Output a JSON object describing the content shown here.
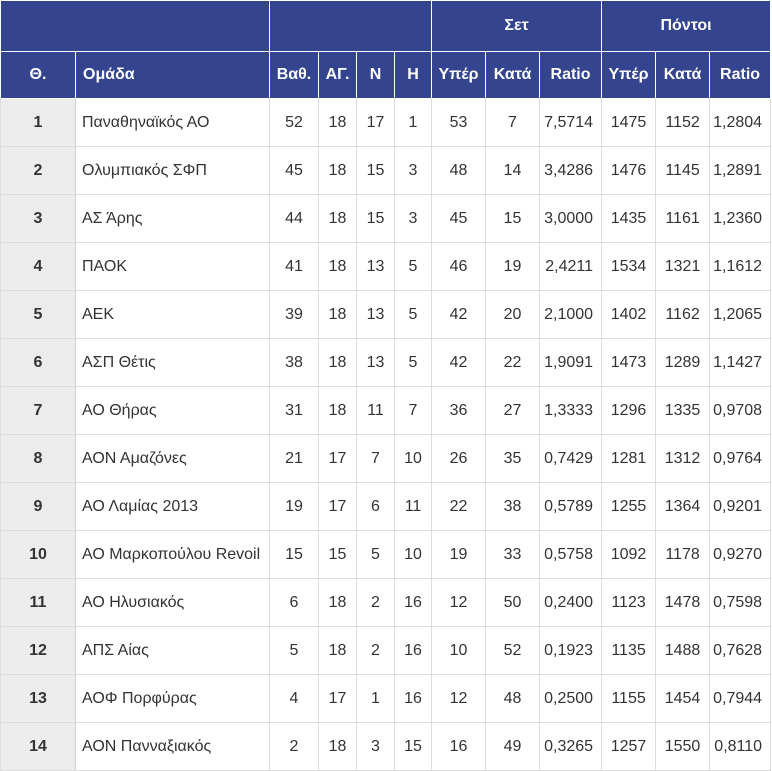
{
  "table": {
    "groups": {
      "sets": "Σετ",
      "points": "Πόντοι"
    },
    "headers": {
      "pos": "Θ.",
      "team": "Ομάδα",
      "pts": "Βαθ.",
      "played": "ΑΓ.",
      "won": "Ν",
      "lost": "Η",
      "sets_for": "Υπέρ",
      "sets_against": "Κατά",
      "sets_ratio": "Ratio",
      "points_for": "Υπέρ",
      "points_against": "Κατά",
      "points_ratio": "Ratio"
    },
    "rows": [
      {
        "pos": "1",
        "team": "Παναθηναϊκός ΑΟ",
        "pts": "52",
        "played": "18",
        "won": "17",
        "lost": "1",
        "sets_for": "53",
        "sets_against": "7",
        "sets_ratio": "7,5714",
        "points_for": "1475",
        "points_against": "1152",
        "points_ratio": "1,2804"
      },
      {
        "pos": "2",
        "team": "Ολυμπιακός ΣΦΠ",
        "pts": "45",
        "played": "18",
        "won": "15",
        "lost": "3",
        "sets_for": "48",
        "sets_against": "14",
        "sets_ratio": "3,4286",
        "points_for": "1476",
        "points_against": "1145",
        "points_ratio": "1,2891"
      },
      {
        "pos": "3",
        "team": "ΑΣ Άρης",
        "pts": "44",
        "played": "18",
        "won": "15",
        "lost": "3",
        "sets_for": "45",
        "sets_against": "15",
        "sets_ratio": "3,0000",
        "points_for": "1435",
        "points_against": "1161",
        "points_ratio": "1,2360"
      },
      {
        "pos": "4",
        "team": "ΠΑΟΚ",
        "pts": "41",
        "played": "18",
        "won": "13",
        "lost": "5",
        "sets_for": "46",
        "sets_against": "19",
        "sets_ratio": "2,4211",
        "points_for": "1534",
        "points_against": "1321",
        "points_ratio": "1,1612"
      },
      {
        "pos": "5",
        "team": "ΑΕΚ",
        "pts": "39",
        "played": "18",
        "won": "13",
        "lost": "5",
        "sets_for": "42",
        "sets_against": "20",
        "sets_ratio": "2,1000",
        "points_for": "1402",
        "points_against": "1162",
        "points_ratio": "1,2065"
      },
      {
        "pos": "6",
        "team": "ΑΣΠ Θέτις",
        "pts": "38",
        "played": "18",
        "won": "13",
        "lost": "5",
        "sets_for": "42",
        "sets_against": "22",
        "sets_ratio": "1,9091",
        "points_for": "1473",
        "points_against": "1289",
        "points_ratio": "1,1427"
      },
      {
        "pos": "7",
        "team": "ΑΟ Θήρας",
        "pts": "31",
        "played": "18",
        "won": "11",
        "lost": "7",
        "sets_for": "36",
        "sets_against": "27",
        "sets_ratio": "1,3333",
        "points_for": "1296",
        "points_against": "1335",
        "points_ratio": "0,9708"
      },
      {
        "pos": "8",
        "team": "ΑΟΝ Αμαζόνες",
        "pts": "21",
        "played": "17",
        "won": "7",
        "lost": "10",
        "sets_for": "26",
        "sets_against": "35",
        "sets_ratio": "0,7429",
        "points_for": "1281",
        "points_against": "1312",
        "points_ratio": "0,9764"
      },
      {
        "pos": "9",
        "team": "ΑΟ Λαμίας 2013",
        "pts": "19",
        "played": "17",
        "won": "6",
        "lost": "11",
        "sets_for": "22",
        "sets_against": "38",
        "sets_ratio": "0,5789",
        "points_for": "1255",
        "points_against": "1364",
        "points_ratio": "0,9201"
      },
      {
        "pos": "10",
        "team": "ΑΟ Μαρκοπούλου Revoil",
        "pts": "15",
        "played": "15",
        "won": "5",
        "lost": "10",
        "sets_for": "19",
        "sets_against": "33",
        "sets_ratio": "0,5758",
        "points_for": "1092",
        "points_against": "1178",
        "points_ratio": "0,9270"
      },
      {
        "pos": "11",
        "team": "ΑΟ Ηλυσιακός",
        "pts": "6",
        "played": "18",
        "won": "2",
        "lost": "16",
        "sets_for": "12",
        "sets_against": "50",
        "sets_ratio": "0,2400",
        "points_for": "1123",
        "points_against": "1478",
        "points_ratio": "0,7598"
      },
      {
        "pos": "12",
        "team": "ΑΠΣ Αίας",
        "pts": "5",
        "played": "18",
        "won": "2",
        "lost": "16",
        "sets_for": "10",
        "sets_against": "52",
        "sets_ratio": "0,1923",
        "points_for": "1135",
        "points_against": "1488",
        "points_ratio": "0,7628"
      },
      {
        "pos": "13",
        "team": "ΑΟΦ Πορφύρας",
        "pts": "4",
        "played": "17",
        "won": "1",
        "lost": "16",
        "sets_for": "12",
        "sets_against": "48",
        "sets_ratio": "0,2500",
        "points_for": "1155",
        "points_against": "1454",
        "points_ratio": "0,7944"
      },
      {
        "pos": "14",
        "team": "ΑΟΝ Πανναξιακός",
        "pts": "2",
        "played": "18",
        "won": "3",
        "lost": "15",
        "sets_for": "16",
        "sets_against": "49",
        "sets_ratio": "0,3265",
        "points_for": "1257",
        "points_against": "1550",
        "points_ratio": "0,8110"
      }
    ]
  },
  "colors": {
    "header_bg": "#34448e",
    "header_text": "#ffffff",
    "position_cell_bg": "#ececec",
    "grid_line": "#dcdcdc"
  }
}
